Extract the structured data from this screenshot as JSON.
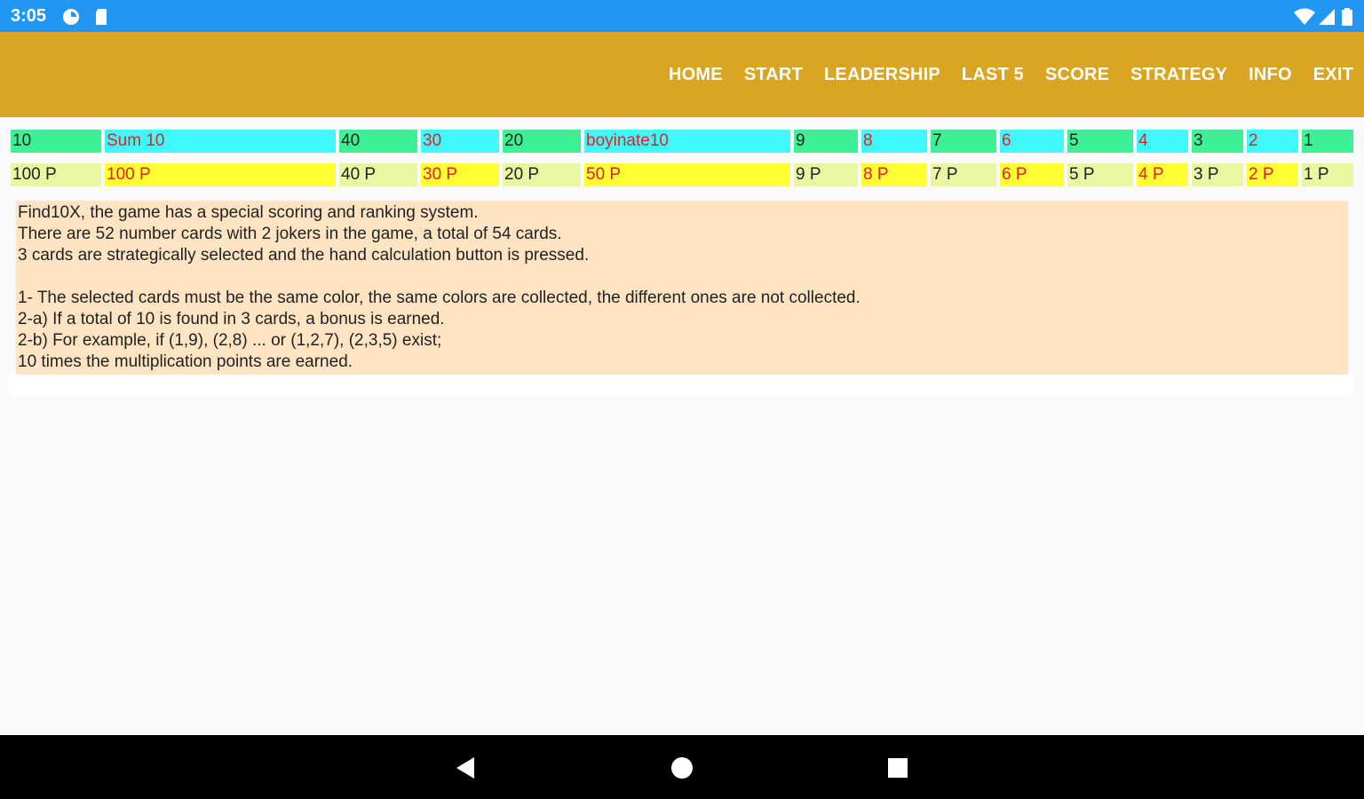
{
  "status_bar": {
    "time": "3:05",
    "left_icons": [
      "data-saver-icon",
      "sd-card-icon"
    ],
    "right_icons": [
      "wifi-icon",
      "signal-icon",
      "battery-icon"
    ],
    "color": "#2196f3"
  },
  "app_bar": {
    "color": "#daa520",
    "menu": [
      {
        "label": "HOME"
      },
      {
        "label": "START"
      },
      {
        "label": "LEADERSHIP"
      },
      {
        "label": "LAST 5"
      },
      {
        "label": "SCORE"
      },
      {
        "label": "STRATEGY"
      },
      {
        "label": "INFO"
      },
      {
        "label": "EXIT"
      }
    ]
  },
  "score_table": {
    "headers": [
      "10",
      "Sum 10",
      "40",
      "30",
      "20",
      "boyinate10",
      "9",
      "8",
      "7",
      "6",
      "5",
      "4",
      "3",
      "2",
      "1"
    ],
    "points": [
      "100 P",
      "100 P",
      "40 P",
      "30 P",
      "20 P",
      "50 P",
      "9 P",
      "8 P",
      "7 P",
      "6 P",
      "5 P",
      "4 P",
      "3 P",
      "2 P",
      "1 P"
    ],
    "colors": {
      "header_green": "#3cf195",
      "header_cyan": "#3ff8fb",
      "points_light": "#e9f6a2",
      "points_yellow": "#ffff33",
      "red_text": "#e52020"
    }
  },
  "info": {
    "lines": [
      "Find10X, the game has a special scoring and ranking system.",
      "There are 52 number cards with 2 jokers in the game, a total of 54 cards.",
      "3 cards are strategically selected and the hand calculation button is pressed.",
      "",
      "1- The selected cards must be the same color, the same colors are collected, the different ones are not collected.",
      "2-a) If a total of 10 is found in 3 cards, a bonus is earned.",
      "2-b) For example, if (1,9), (2,8) ... or (1,2,7), (2,3,5) exist;",
      "10 times the multiplication points are earned."
    ],
    "background": "#ffe4c4"
  },
  "nav_bar": {
    "buttons": [
      "back-icon",
      "home-icon",
      "recents-icon"
    ]
  }
}
